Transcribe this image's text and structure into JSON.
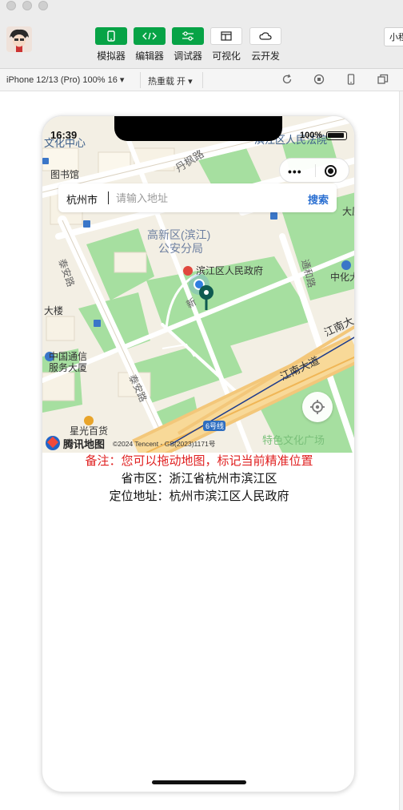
{
  "toolbar": {
    "tools": [
      {
        "label": "模拟器",
        "icon": "phone-icon",
        "active": true
      },
      {
        "label": "编辑器",
        "icon": "code-icon",
        "active": true
      },
      {
        "label": "调试器",
        "icon": "debug-sliders-icon",
        "active": true
      },
      {
        "label": "可视化",
        "icon": "layout-icon",
        "active": false
      },
      {
        "label": "云开发",
        "icon": "cloud-icon",
        "active": false
      }
    ],
    "corner_label": "小程"
  },
  "subbar": {
    "device": "iPhone 12/13 (Pro) 100% 16 ▾",
    "hot_reload": "热重载 开 ▾"
  },
  "phone": {
    "status_time": "16:39",
    "battery_percent": "100%",
    "search": {
      "city": "杭州市",
      "placeholder": "请输入地址",
      "button": "搜索"
    },
    "map_labels": {
      "l1": "文化中心",
      "l2": "丹枫路",
      "l3": "滨江区人民法院",
      "l4": "图书馆",
      "l5": "高新区(滨江)",
      "l6": "公安分局",
      "l7": "滨江区人民政府",
      "l8": "大厦",
      "l9": "泰安路",
      "l10": "通和路",
      "l11": "中化大",
      "l12": "大楼",
      "l13": "新",
      "l14": "江南大",
      "l15": "中国通信",
      "l16": "服务大厦",
      "l17": "江南大道",
      "l18": "泰安路",
      "l19": "星光百货",
      "l20": "6号线",
      "l21": "特色文化广场"
    },
    "map_logo": "腾讯地图",
    "copyright": "©2024 Tencent - GS(2023)1171号",
    "note": "备注：您可以拖动地图，标记当前精准位置",
    "region_line": "省市区：浙江省杭州市滨江区",
    "address_line": "定位地址：杭州市滨江区人民政府",
    "colors": {
      "note_red": "#e02020",
      "search_blue": "#2a6fd1",
      "marker_teal": "#0f5a50",
      "toolbar_green": "#07a346"
    }
  }
}
